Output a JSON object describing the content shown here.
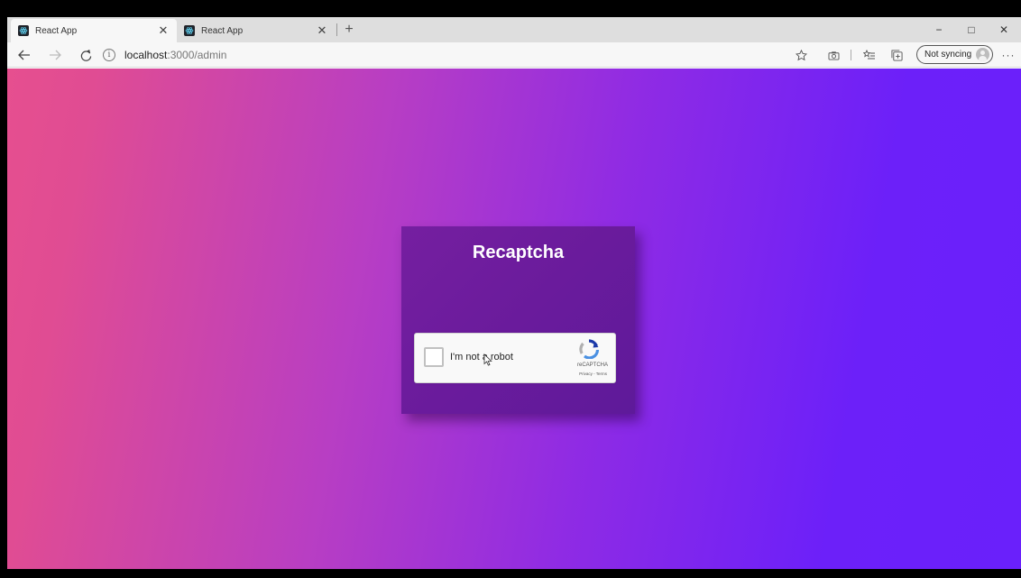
{
  "tabs": [
    {
      "title": "React App",
      "active": true
    },
    {
      "title": "React App",
      "active": false
    }
  ],
  "window_controls": {
    "minimize": "−",
    "maximize": "□",
    "close": "✕"
  },
  "address_bar": {
    "host": "localhost",
    "path": ":3000/admin"
  },
  "sync": {
    "label": "Not syncing"
  },
  "page": {
    "title": "Recaptcha"
  },
  "recaptcha": {
    "label": "I'm not a robot",
    "brand": "reCAPTCHA",
    "links": "Privacy - Terms",
    "checked": false
  },
  "colors": {
    "gradient_left": "#e64f8f",
    "gradient_right": "#6a20fb",
    "card": "#6a1b9c"
  },
  "icons": {
    "back": "back-arrow-icon",
    "forward": "forward-arrow-icon",
    "refresh": "refresh-icon",
    "info": "info-icon",
    "favorite": "star-icon",
    "screenshot": "camera-icon",
    "favorites_list": "favorites-icon",
    "collections": "collections-icon",
    "more": "more-icon"
  }
}
